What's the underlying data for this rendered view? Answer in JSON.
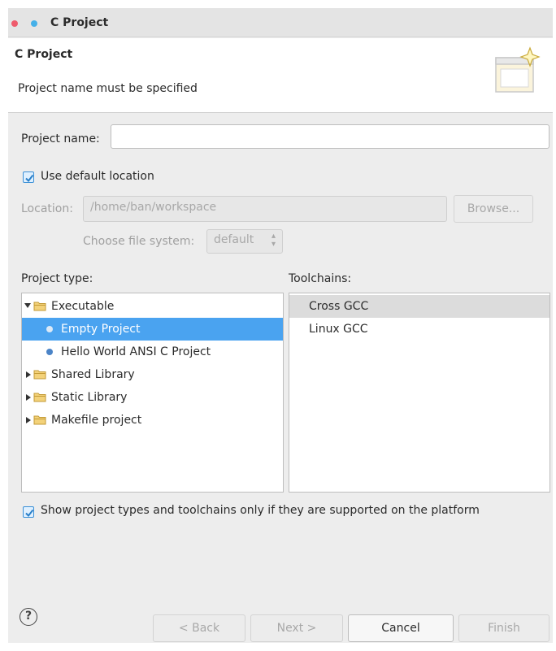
{
  "window": {
    "title": "C Project"
  },
  "header": {
    "title": "C Project",
    "message": "Project name must be specified"
  },
  "project_name": {
    "label": "Project name:",
    "value": ""
  },
  "default_location": {
    "label": "Use default location",
    "checked": true
  },
  "location": {
    "label": "Location:",
    "value": "/home/ban/workspace",
    "browse_label": "Browse..."
  },
  "file_system": {
    "label": "Choose file system:",
    "value": "default"
  },
  "project_type": {
    "label": "Project type:",
    "items": [
      {
        "label": "Executable",
        "kind": "folder",
        "expanded": true
      },
      {
        "label": "Empty Project",
        "kind": "leaf",
        "selected": true
      },
      {
        "label": "Hello World ANSI C Project",
        "kind": "leaf"
      },
      {
        "label": "Shared Library",
        "kind": "folder",
        "expanded": false
      },
      {
        "label": "Static Library",
        "kind": "folder",
        "expanded": false
      },
      {
        "label": "Makefile project",
        "kind": "folder",
        "expanded": false
      }
    ]
  },
  "toolchains": {
    "label": "Toolchains:",
    "items": [
      {
        "label": "Cross GCC",
        "selected": true
      },
      {
        "label": "Linux GCC"
      }
    ]
  },
  "filter": {
    "label": "Show project types and toolchains only if they are supported on the platform",
    "checked": true
  },
  "buttons": {
    "help": "?",
    "back": "< Back",
    "next": "Next >",
    "cancel": "Cancel",
    "finish": "Finish"
  },
  "colors": {
    "accent": "#4aa3f0",
    "close_dot": "#ee5b6c",
    "min_dot": "#45b0e8"
  }
}
